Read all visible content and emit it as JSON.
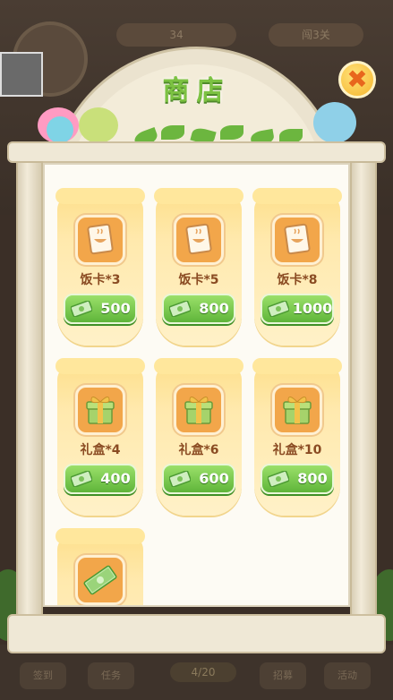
{
  "background": {
    "top_pill_left": "34",
    "top_pill_right": "闯3关",
    "bottom_tabs": [
      "签到",
      "任务",
      "招募",
      "活动"
    ],
    "bottom_progress": "4/20"
  },
  "shop": {
    "title": "商店",
    "close_symbol": "✖",
    "items": [
      {
        "name": "饭卡*3",
        "price": "500",
        "icon": "meal-card-icon"
      },
      {
        "name": "饭卡*5",
        "price": "800",
        "icon": "meal-card-icon"
      },
      {
        "name": "饭卡*8",
        "price": "1000",
        "icon": "meal-card-icon"
      },
      {
        "name": "礼盒*4",
        "price": "400",
        "icon": "gift-box-icon"
      },
      {
        "name": "礼盒*6",
        "price": "600",
        "icon": "gift-box-icon"
      },
      {
        "name": "礼盒*10",
        "price": "800",
        "icon": "gift-box-icon"
      },
      {
        "name": "",
        "price": "",
        "icon": "cash-bundle-icon"
      }
    ]
  },
  "colors": {
    "card": "#ffe9ad",
    "price_button": "#6cc043",
    "title": "#7cc242",
    "close": "#f5b52c"
  }
}
